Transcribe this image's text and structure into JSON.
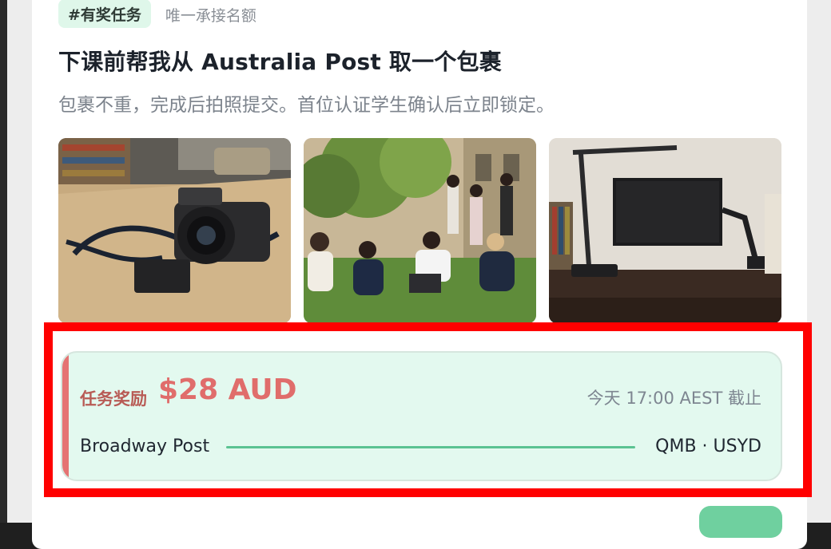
{
  "task": {
    "tags": [
      "#有奖任务",
      "唯一承接名额"
    ],
    "title": "下课前帮我从 Australia Post 取一个包裹",
    "description": "包裹不重，完成后拍照提交。首位认证学生确认后立即锁定。",
    "photos": [
      {
        "name": "camera-photo"
      },
      {
        "name": "campus-students-photo"
      },
      {
        "name": "desk-monitor-photo"
      }
    ]
  },
  "reward": {
    "label": "任务奖励",
    "amount": "$28 AUD",
    "deadline": "今天 17:00 AEST 截止",
    "from": "Broadway Post",
    "to": "QMB · USYD"
  },
  "colors": {
    "accent_green": "#5bc392",
    "reward_red": "#e06d6b",
    "highlight_box": "#ff0000"
  }
}
